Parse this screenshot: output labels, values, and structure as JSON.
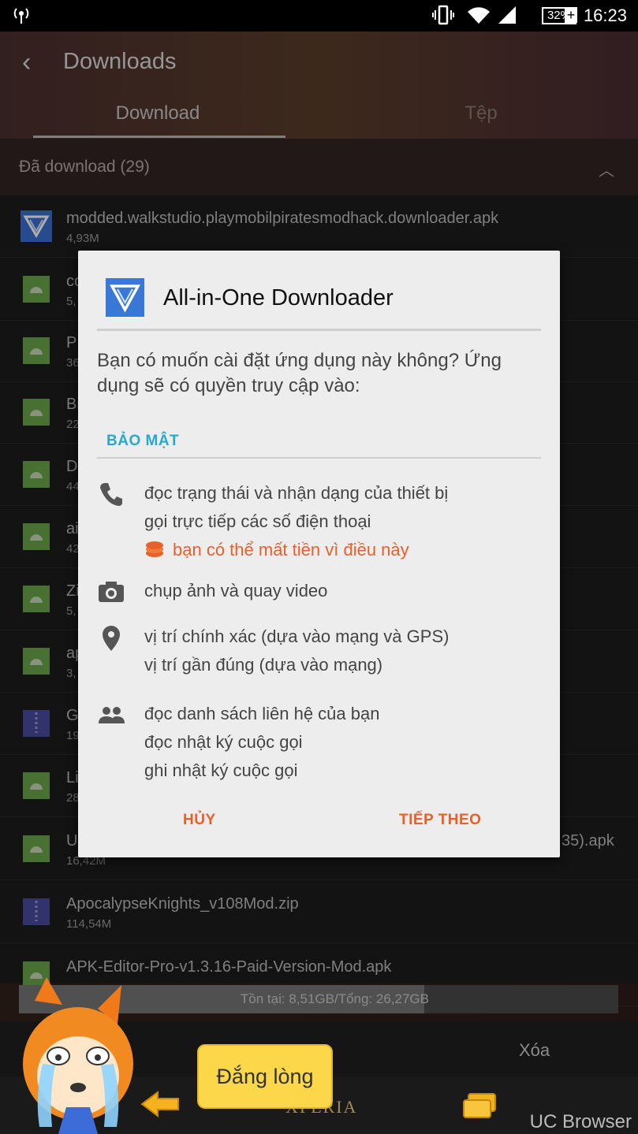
{
  "status_bar": {
    "time": "16:23",
    "battery": "32%"
  },
  "header": {
    "title": "Downloads",
    "tabs": [
      "Download",
      "Tệp"
    ]
  },
  "section": {
    "label": "Đã download (29)"
  },
  "list": [
    {
      "name": "modded.walkstudio.playmobilpiratesmodhack.downloader.apk",
      "size": "4,93M",
      "icon": "aio-icon"
    },
    {
      "name": "co",
      "size": "5,",
      "icon": "android-icon"
    },
    {
      "name": "P",
      "size": "36",
      "icon": "android-icon"
    },
    {
      "name": "Bi",
      "size": "22",
      "icon": "android-icon"
    },
    {
      "name": "D",
      "size": "44",
      "icon": "android-icon"
    },
    {
      "name": "ai",
      "size": "42",
      "icon": "android-icon"
    },
    {
      "name": "Zi",
      "size": "5,",
      "icon": "android-icon"
    },
    {
      "name": "ap",
      "size": "3,",
      "icon": "android-icon"
    },
    {
      "name": "G",
      "size": "19",
      "icon": "zip-icon"
    },
    {
      "name": "Li",
      "size": "28",
      "icon": "android-icon"
    },
    {
      "name": "U",
      "size": "16,42M",
      "icon": "android-icon",
      "suffix": "35).apk"
    },
    {
      "name": "ApocalypseKnights_v108Mod.zip",
      "size": "114,54M",
      "icon": "zip-icon"
    },
    {
      "name": "APK-Editor-Pro-v1.3.16-Paid-Version-Mod.apk",
      "size": "",
      "icon": "android-icon"
    }
  ],
  "storage": {
    "text": "Tồn tại: 8,51GB/Tổng: 26,27GB",
    "used_fraction": 0.676
  },
  "bottom_action": "Xóa",
  "uc_bar": {
    "brand": "UC Browser",
    "device_label": "XPERIA",
    "bubble_text": "Đắng lòng"
  },
  "dialog": {
    "app_name": "All-in-One Downloader",
    "question": "Bạn có muốn cài đặt ứng dụng này không? Ứng dụng sẽ có quyền truy cập vào:",
    "section": "BẢO MẬT",
    "permissions": [
      {
        "icon": "phone-icon",
        "lines": [
          "đọc trạng thái và nhận dạng của thiết bị",
          "gọi trực tiếp các số điện thoại"
        ],
        "warning": "bạn có thể mất tiền vì điều này"
      },
      {
        "icon": "camera-icon",
        "lines": [
          "chụp ảnh và quay video"
        ]
      },
      {
        "icon": "location-icon",
        "lines": [
          "vị trí chính xác (dựa vào mạng và GPS)",
          "vị trí gần đúng (dựa vào mạng)"
        ]
      },
      {
        "icon": "contacts-icon",
        "lines": [
          "đọc danh sách liên hệ của bạn",
          "đọc nhật ký cuộc gọi",
          "ghi nhật ký cuộc gọi"
        ]
      }
    ],
    "cancel": "HỦY",
    "next": "TIẾP THEO"
  },
  "colors": {
    "accent_blue": "#2aa7c9",
    "accent_orange": "#e8602a",
    "dialog_bg": "#ededed",
    "bubble": "#fcd74a"
  }
}
